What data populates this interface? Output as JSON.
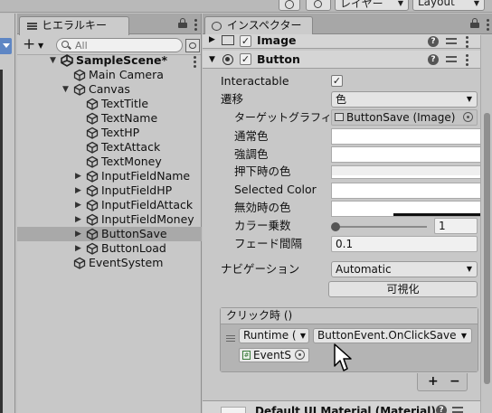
{
  "toolbar": {
    "history_icon": "history-icon",
    "search_icon": "search-icon",
    "layers_label": "レイヤー",
    "layout_label": "Layout"
  },
  "hierarchy": {
    "tab_label": "ヒエラルキー",
    "add_label": "+",
    "search_placeholder": "All",
    "scene_name": "SampleScene*",
    "items": [
      {
        "label": "Main Camera"
      },
      {
        "label": "Canvas"
      },
      {
        "label": "TextTitle"
      },
      {
        "label": "TextName"
      },
      {
        "label": "TextHP"
      },
      {
        "label": "TextAttack"
      },
      {
        "label": "TextMoney"
      },
      {
        "label": "InputFieldName"
      },
      {
        "label": "InputFieldHP"
      },
      {
        "label": "InputFieldAttack"
      },
      {
        "label": "InputFieldMoney"
      },
      {
        "label": "ButtonSave"
      },
      {
        "label": "ButtonLoad"
      },
      {
        "label": "EventSystem"
      }
    ],
    "selected_item": "ButtonSave"
  },
  "inspector": {
    "tab_label": "インスペクター",
    "image_component": {
      "title": "Image",
      "enabled": true
    },
    "button_component": {
      "title": "Button",
      "enabled": true,
      "interactable_label": "Interactable",
      "interactable": true,
      "transition_label": "遷移",
      "transition_value": "色",
      "target_graphic_label": "ターゲットグラフィックス",
      "target_graphic_value": "ButtonSave (Image)",
      "normal_color_label": "通常色",
      "highlighted_color_label": "強調色",
      "pressed_color_label": "押下時の色",
      "selected_color_label": "Selected Color",
      "disabled_color_label": "無効時の色",
      "color_multiplier_label": "カラー乗数",
      "color_multiplier_value": "1",
      "color_multiplier_fraction": 0,
      "fade_duration_label": "フェード間隔",
      "fade_duration_value": "0.1",
      "navigation_label": "ナビゲーション",
      "navigation_value": "Automatic",
      "visualize_label": "可視化"
    },
    "on_click": {
      "header": "クリック時 ()",
      "runtime_value": "Runtime (",
      "function_value": "ButtonEvent.OnClickSave",
      "object_value": "EventS",
      "add_label": "+",
      "remove_label": "−"
    },
    "material_label": "Default UI Material (Material)"
  }
}
